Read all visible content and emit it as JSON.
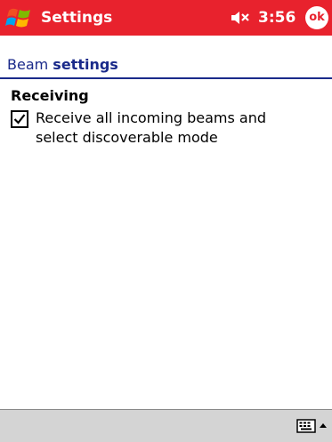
{
  "titlebar": {
    "app_title": "Settings",
    "time": "3:56",
    "ok_label": "ok",
    "start_icon": "windows-flag-icon",
    "volume_icon": "speaker-mute-icon",
    "bg_color": "#e8222d"
  },
  "header": {
    "title_prefix": "Beam ",
    "title_bold": "settings"
  },
  "receiving": {
    "heading": "Receiving",
    "checkbox_label": "Receive all incoming beams and select discoverable mode",
    "checked": true
  },
  "bottombar": {
    "keyboard_icon": "keyboard-icon",
    "arrow_icon": "up-arrow-icon"
  }
}
